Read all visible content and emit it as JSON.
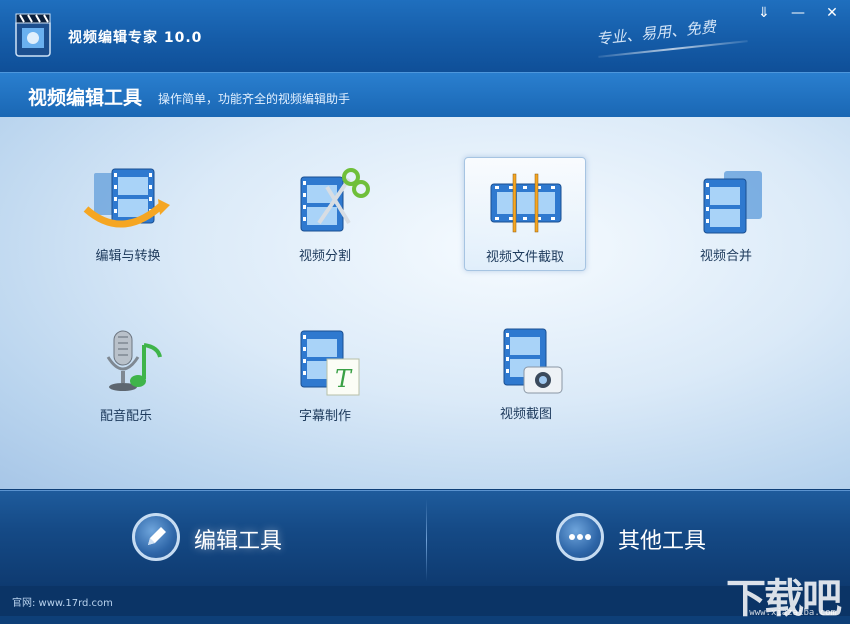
{
  "app": {
    "title": "视频编辑专家 10.0",
    "slogan": "专业、易用、免费"
  },
  "window": {
    "min_symbol": "⇓",
    "minimize_symbol": "—",
    "close_symbol": "✕"
  },
  "section": {
    "title": "视频编辑工具",
    "description": "操作简单，功能齐全的视频编辑助手"
  },
  "tools": [
    {
      "label": "编辑与转换",
      "icon": "film-convert-icon"
    },
    {
      "label": "视频分割",
      "icon": "film-scissors-icon"
    },
    {
      "label": "视频文件截取",
      "icon": "film-trim-icon",
      "selected": true
    },
    {
      "label": "视频合并",
      "icon": "film-merge-icon"
    },
    {
      "label": "配音配乐",
      "icon": "microphone-music-icon"
    },
    {
      "label": "字幕制作",
      "icon": "film-subtitle-icon"
    },
    {
      "label": "视频截图",
      "icon": "film-camera-icon"
    }
  ],
  "bottom": {
    "edit_tools": "编辑工具",
    "other_tools": "其他工具"
  },
  "footer": {
    "site": "官网: www.17rd.com",
    "watermark": "下载吧",
    "watermark_url": "www.xiazaiba.com"
  },
  "colors": {
    "title_bar": "#155ca8",
    "subheader": "#1a67b4",
    "content_bg": "#dbeaf8",
    "bottom_bar": "#154a86",
    "film_blue": "#2f79cf",
    "accent_orange": "#f5a623"
  }
}
